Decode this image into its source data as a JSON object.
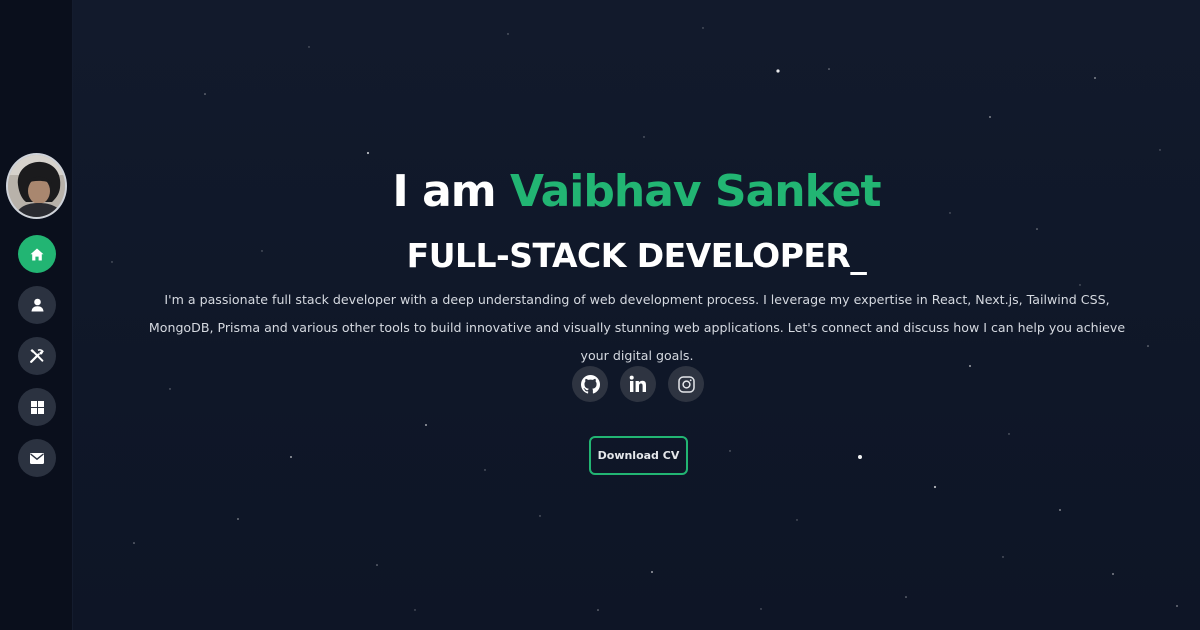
{
  "sidebar": {
    "avatar_icon": "profile-photo",
    "items": [
      {
        "id": "home",
        "icon": "home-icon",
        "active": true
      },
      {
        "id": "about",
        "icon": "user-icon",
        "active": false
      },
      {
        "id": "skills",
        "icon": "tools-icon",
        "active": false
      },
      {
        "id": "projects",
        "icon": "grid-icon",
        "active": false
      },
      {
        "id": "contact",
        "icon": "envelope-icon",
        "active": false
      }
    ]
  },
  "hero": {
    "intro": "I am ",
    "name": "Vaibhav Sanket",
    "role": "FULL-STACK DEVELOPER",
    "cursor": "_",
    "bio": "I'm a passionate full stack developer with a deep understanding of web development process. I leverage my expertise in React, Next.js, Tailwind CSS, MongoDB, Prisma and various other tools to build innovative and visually stunning web applications. Let's connect and discuss how I can help you achieve your digital goals.",
    "socials": [
      {
        "icon": "github-icon"
      },
      {
        "icon": "linkedin-icon"
      },
      {
        "icon": "instagram-icon"
      }
    ],
    "cta_label": "Download CV"
  },
  "colors": {
    "accent": "#22b573",
    "background": "#111827",
    "sidebar": "#0a0f1c",
    "button": "#2b3240"
  }
}
